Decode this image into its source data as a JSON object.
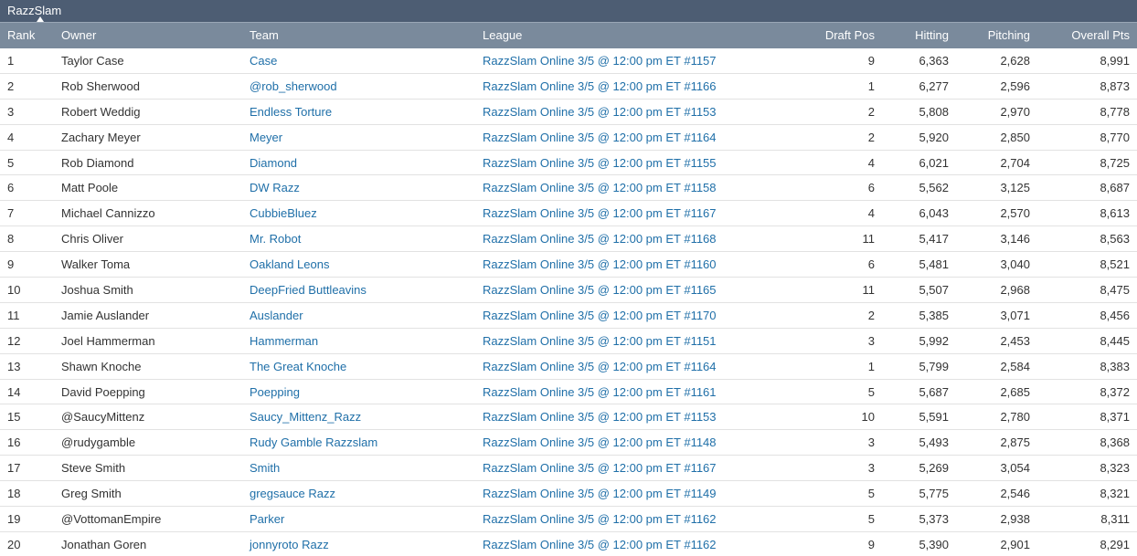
{
  "tab": {
    "label": "RazzSlam"
  },
  "columns": {
    "rank": "Rank",
    "owner": "Owner",
    "team": "Team",
    "league": "League",
    "draft_pos": "Draft Pos",
    "hitting": "Hitting",
    "pitching": "Pitching",
    "overall": "Overall Pts"
  },
  "rows": [
    {
      "rank": "1",
      "owner": "Taylor Case",
      "team": "Case",
      "league": "RazzSlam Online 3/5 @ 12:00 pm ET #1157",
      "draft_pos": "9",
      "hitting": "6,363",
      "pitching": "2,628",
      "overall": "8,991"
    },
    {
      "rank": "2",
      "owner": "Rob Sherwood",
      "team": "@rob_sherwood",
      "league": "RazzSlam Online 3/5 @ 12:00 pm ET #1166",
      "draft_pos": "1",
      "hitting": "6,277",
      "pitching": "2,596",
      "overall": "8,873"
    },
    {
      "rank": "3",
      "owner": "Robert Weddig",
      "team": "Endless Torture",
      "league": "RazzSlam Online 3/5 @ 12:00 pm ET #1153",
      "draft_pos": "2",
      "hitting": "5,808",
      "pitching": "2,970",
      "overall": "8,778"
    },
    {
      "rank": "4",
      "owner": "Zachary Meyer",
      "team": "Meyer",
      "league": "RazzSlam Online 3/5 @ 12:00 pm ET #1164",
      "draft_pos": "2",
      "hitting": "5,920",
      "pitching": "2,850",
      "overall": "8,770"
    },
    {
      "rank": "5",
      "owner": "Rob Diamond",
      "team": "Diamond",
      "league": "RazzSlam Online 3/5 @ 12:00 pm ET #1155",
      "draft_pos": "4",
      "hitting": "6,021",
      "pitching": "2,704",
      "overall": "8,725"
    },
    {
      "rank": "6",
      "owner": "Matt Poole",
      "team": "DW Razz",
      "league": "RazzSlam Online 3/5 @ 12:00 pm ET #1158",
      "draft_pos": "6",
      "hitting": "5,562",
      "pitching": "3,125",
      "overall": "8,687"
    },
    {
      "rank": "7",
      "owner": "Michael Cannizzo",
      "team": "CubbieBluez",
      "league": "RazzSlam Online 3/5 @ 12:00 pm ET #1167",
      "draft_pos": "4",
      "hitting": "6,043",
      "pitching": "2,570",
      "overall": "8,613"
    },
    {
      "rank": "8",
      "owner": "Chris Oliver",
      "team": "Mr. Robot",
      "league": "RazzSlam Online 3/5 @ 12:00 pm ET #1168",
      "draft_pos": "11",
      "hitting": "5,417",
      "pitching": "3,146",
      "overall": "8,563"
    },
    {
      "rank": "9",
      "owner": "Walker Toma",
      "team": "Oakland Leons",
      "league": "RazzSlam Online 3/5 @ 12:00 pm ET #1160",
      "draft_pos": "6",
      "hitting": "5,481",
      "pitching": "3,040",
      "overall": "8,521"
    },
    {
      "rank": "10",
      "owner": "Joshua Smith",
      "team": "DeepFried Buttleavins",
      "league": "RazzSlam Online 3/5 @ 12:00 pm ET #1165",
      "draft_pos": "11",
      "hitting": "5,507",
      "pitching": "2,968",
      "overall": "8,475"
    },
    {
      "rank": "11",
      "owner": "Jamie Auslander",
      "team": "Auslander",
      "league": "RazzSlam Online 3/5 @ 12:00 pm ET #1170",
      "draft_pos": "2",
      "hitting": "5,385",
      "pitching": "3,071",
      "overall": "8,456"
    },
    {
      "rank": "12",
      "owner": "Joel Hammerman",
      "team": "Hammerman",
      "league": "RazzSlam Online 3/5 @ 12:00 pm ET #1151",
      "draft_pos": "3",
      "hitting": "5,992",
      "pitching": "2,453",
      "overall": "8,445"
    },
    {
      "rank": "13",
      "owner": "Shawn Knoche",
      "team": "The Great Knoche",
      "league": "RazzSlam Online 3/5 @ 12:00 pm ET #1164",
      "draft_pos": "1",
      "hitting": "5,799",
      "pitching": "2,584",
      "overall": "8,383"
    },
    {
      "rank": "14",
      "owner": "David Poepping",
      "team": "Poepping",
      "league": "RazzSlam Online 3/5 @ 12:00 pm ET #1161",
      "draft_pos": "5",
      "hitting": "5,687",
      "pitching": "2,685",
      "overall": "8,372"
    },
    {
      "rank": "15",
      "owner": "@SaucyMittenz",
      "team": "Saucy_Mittenz_Razz",
      "league": "RazzSlam Online 3/5 @ 12:00 pm ET #1153",
      "draft_pos": "10",
      "hitting": "5,591",
      "pitching": "2,780",
      "overall": "8,371"
    },
    {
      "rank": "16",
      "owner": "@rudygamble",
      "team": "Rudy Gamble Razzslam",
      "league": "RazzSlam Online 3/5 @ 12:00 pm ET #1148",
      "draft_pos": "3",
      "hitting": "5,493",
      "pitching": "2,875",
      "overall": "8,368"
    },
    {
      "rank": "17",
      "owner": "Steve Smith",
      "team": "Smith",
      "league": "RazzSlam Online 3/5 @ 12:00 pm ET #1167",
      "draft_pos": "3",
      "hitting": "5,269",
      "pitching": "3,054",
      "overall": "8,323"
    },
    {
      "rank": "18",
      "owner": "Greg Smith",
      "team": "gregsauce Razz",
      "league": "RazzSlam Online 3/5 @ 12:00 pm ET #1149",
      "draft_pos": "5",
      "hitting": "5,775",
      "pitching": "2,546",
      "overall": "8,321"
    },
    {
      "rank": "19",
      "owner": "@VottomanEmpire",
      "team": "Parker",
      "league": "RazzSlam Online 3/5 @ 12:00 pm ET #1162",
      "draft_pos": "5",
      "hitting": "5,373",
      "pitching": "2,938",
      "overall": "8,311"
    },
    {
      "rank": "20",
      "owner": "Jonathan Goren",
      "team": "jonnyroto Razz",
      "league": "RazzSlam Online 3/5 @ 12:00 pm ET #1162",
      "draft_pos": "9",
      "hitting": "5,390",
      "pitching": "2,901",
      "overall": "8,291"
    }
  ]
}
